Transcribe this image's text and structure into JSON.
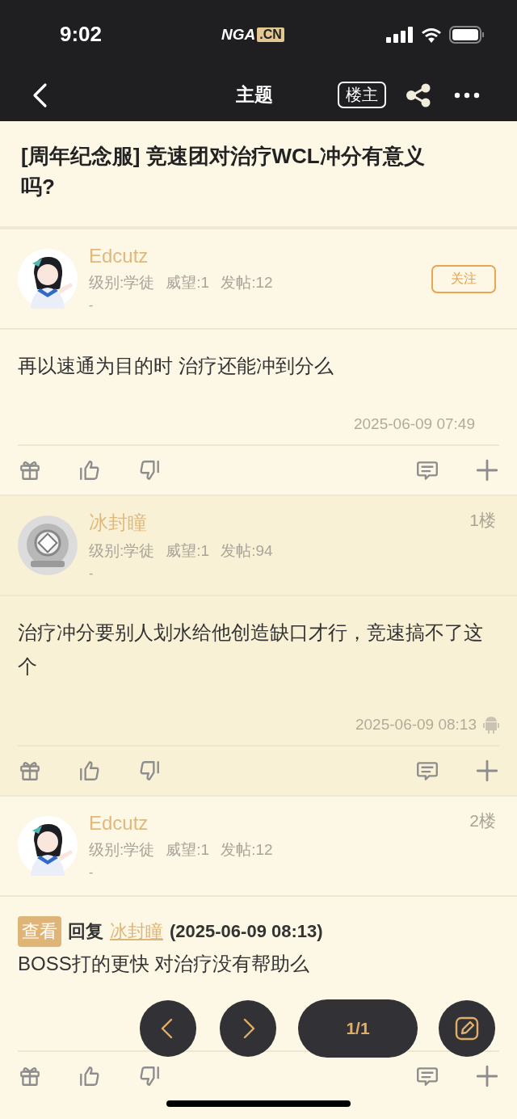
{
  "status_bar": {
    "time": "9:02",
    "logo_main": "NGA",
    "logo_suffix": ".CN"
  },
  "nav_bar": {
    "title": "主题",
    "op_filter": "楼主"
  },
  "thread": {
    "title": "[周年纪念服] 竞速团对治疗WCL冲分有意义吗?"
  },
  "posts": [
    {
      "author": "Edcutz",
      "meta": [
        "级别:学徒",
        "威望:1",
        "发帖:12"
      ],
      "signature": "-",
      "follow_label": "关注",
      "highlighted": false,
      "content": "再以速通为目的时 治疗还能冲到分么",
      "timestamp": "2025-06-09 07:49"
    },
    {
      "author": "冰封瞳",
      "floor": "1楼",
      "meta": [
        "级别:学徒",
        "威望:1",
        "发帖:94"
      ],
      "signature": "-",
      "highlighted": true,
      "content": "治疗冲分要别人划水给他创造缺口才行，竞速搞不了这个",
      "timestamp": "2025-06-09 08:13"
    },
    {
      "author": "Edcutz",
      "floor": "2楼",
      "meta": [
        "级别:学徒",
        "威望:1",
        "发帖:12"
      ],
      "signature": "-",
      "highlighted": false,
      "reply": {
        "tag": "查看",
        "verb": "回复",
        "user": "冰封瞳",
        "time": "(2025-06-09 08:13)"
      },
      "content": "BOSS打的更快 对治疗没有帮助么"
    }
  ],
  "pager": {
    "page": "1/1"
  }
}
